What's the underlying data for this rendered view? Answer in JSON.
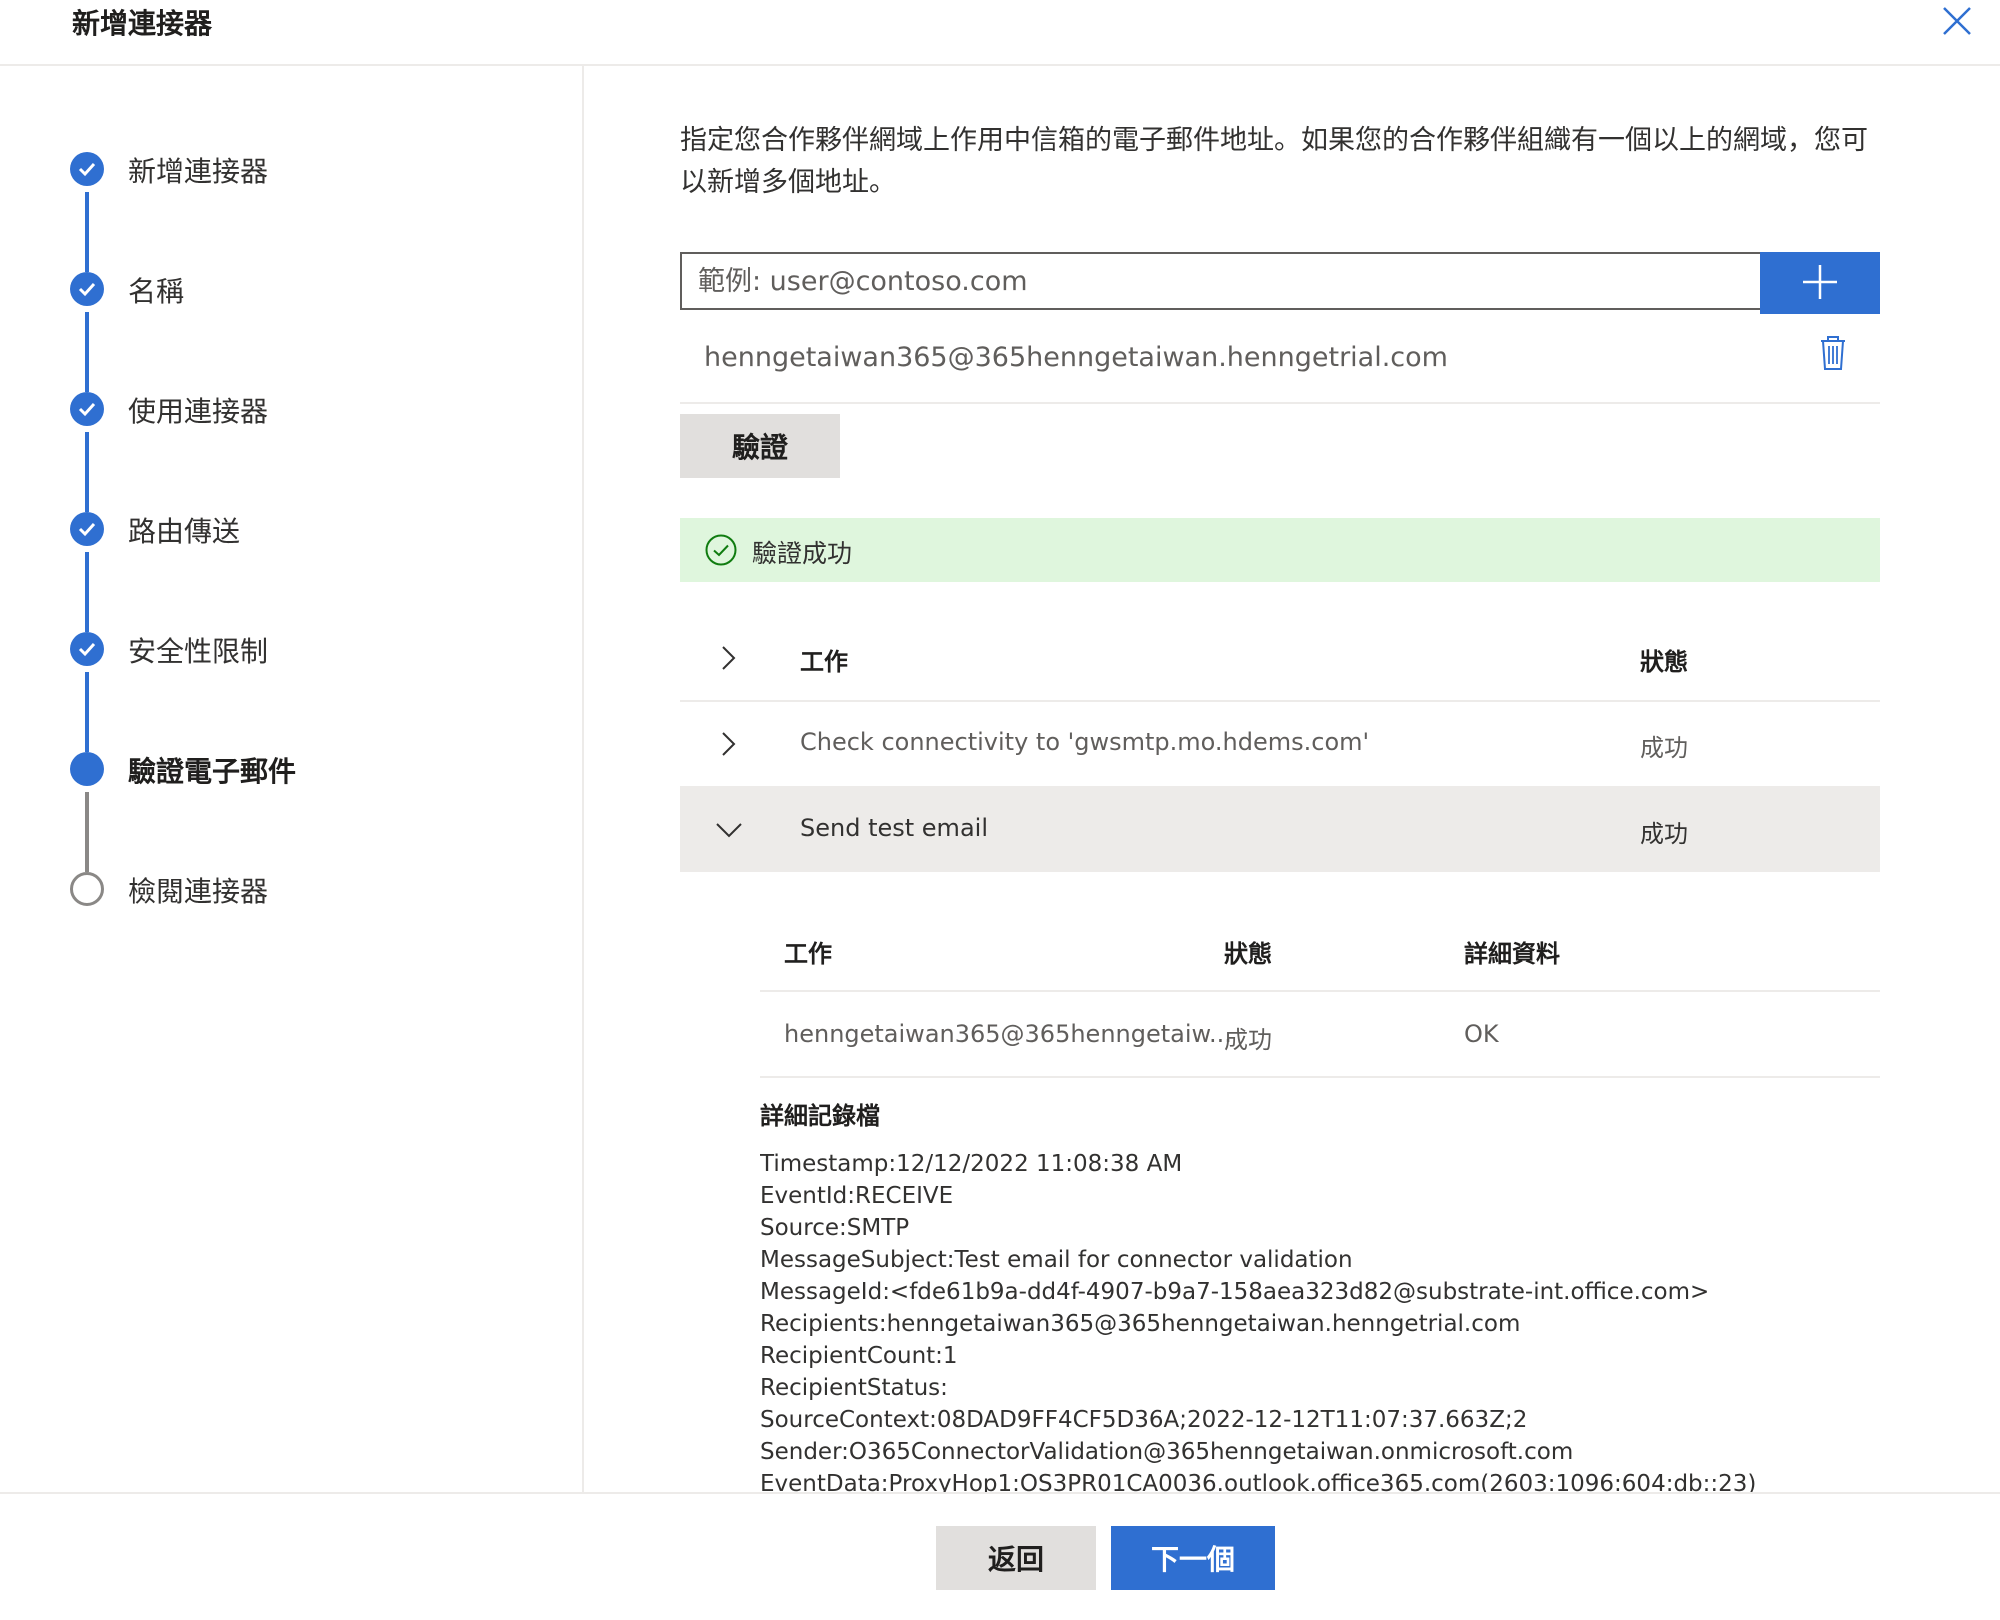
{
  "dialog": {
    "title": "新增連接器"
  },
  "steps": [
    {
      "label": "新增連接器",
      "state": "done"
    },
    {
      "label": "名稱",
      "state": "done"
    },
    {
      "label": "使用連接器",
      "state": "done"
    },
    {
      "label": "路由傳送",
      "state": "done"
    },
    {
      "label": "安全性限制",
      "state": "done"
    },
    {
      "label": "驗證電子郵件",
      "state": "current"
    },
    {
      "label": "檢閱連接器",
      "state": "todo"
    }
  ],
  "main": {
    "description": "指定您合作夥伴網域上作用中信箱的電子郵件地址。如果您的合作夥伴組織有一個以上的網域，您可以新增多個地址。",
    "email_input": {
      "placeholder": "範例: user@contoso.com",
      "value": ""
    },
    "added_email": "henngetaiwan365@365henngetaiwan.henngetrial.com",
    "verify_button": "驗證",
    "success_message": "驗證成功"
  },
  "results_table": {
    "headers": {
      "task": "工作",
      "status": "狀態"
    },
    "rows": [
      {
        "task": "Check connectivity to 'gwsmtp.mo.hdems.com'",
        "status": "成功",
        "expanded": false
      },
      {
        "task": "Send test email",
        "status": "成功",
        "expanded": true
      }
    ]
  },
  "sub_table": {
    "headers": {
      "task": "工作",
      "status": "狀態",
      "details": "詳細資料"
    },
    "row": {
      "task": "henngetaiwan365@365henngetaiw...",
      "status": "成功",
      "details": "OK"
    }
  },
  "log": {
    "title": "詳細記錄檔",
    "lines": [
      "Timestamp:12/12/2022 11:08:38 AM",
      "EventId:RECEIVE",
      "Source:SMTP",
      "MessageSubject:Test email for connector validation",
      "MessageId:<fde61b9a-dd4f-4907-b9a7-158aea323d82@substrate-int.office.com>",
      "Recipients:henngetaiwan365@365henngetaiwan.henngetrial.com",
      "RecipientCount:1",
      "RecipientStatus:",
      "SourceContext:08DAD9FF4CF5D36A;2022-12-12T11:07:37.663Z;2",
      "Sender:O365ConnectorValidation@365henngetaiwan.onmicrosoft.com",
      "EventData:ProxyHop1:OS3PR01CA0036.outlook.office365.com(2603:1096:604:db::23)"
    ]
  },
  "footer": {
    "back_label": "返回",
    "next_label": "下一個"
  },
  "colors": {
    "accent": "#2f6fd1",
    "success_bg": "#dff6dd",
    "success_icon": "#107c10"
  }
}
